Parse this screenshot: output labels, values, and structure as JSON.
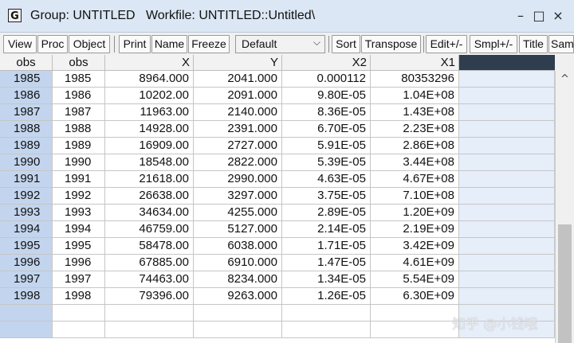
{
  "window": {
    "icon_letter": "G",
    "title": "Group: UNTITLED",
    "workfile": "Workfile: UNTITLED::Untitled\\",
    "minimize": "–",
    "maximize": "□",
    "close": "×"
  },
  "toolbar": {
    "buttons1": [
      "View",
      "Proc",
      "Object"
    ],
    "buttons2": [
      "Print",
      "Name",
      "Freeze"
    ],
    "select_value": "Default",
    "buttons3": [
      "Sort",
      "Transpose"
    ],
    "buttons4": [
      "Edit+/-",
      "Smpl+/-",
      "Title",
      "Sam"
    ]
  },
  "table": {
    "columns": [
      "obs",
      "obs",
      "X",
      "Y",
      "X2",
      "X1"
    ],
    "rows": [
      [
        "1985",
        "1985",
        "8964.000",
        "2041.000",
        "0.000112",
        "80353296"
      ],
      [
        "1986",
        "1986",
        "10202.00",
        "2091.000",
        "9.80E-05",
        "1.04E+08"
      ],
      [
        "1987",
        "1987",
        "11963.00",
        "2140.000",
        "8.36E-05",
        "1.43E+08"
      ],
      [
        "1988",
        "1988",
        "14928.00",
        "2391.000",
        "6.70E-05",
        "2.23E+08"
      ],
      [
        "1989",
        "1989",
        "16909.00",
        "2727.000",
        "5.91E-05",
        "2.86E+08"
      ],
      [
        "1990",
        "1990",
        "18548.00",
        "2822.000",
        "5.39E-05",
        "3.44E+08"
      ],
      [
        "1991",
        "1991",
        "21618.00",
        "2990.000",
        "4.63E-05",
        "4.67E+08"
      ],
      [
        "1992",
        "1992",
        "26638.00",
        "3297.000",
        "3.75E-05",
        "7.10E+08"
      ],
      [
        "1993",
        "1993",
        "34634.00",
        "4255.000",
        "2.89E-05",
        "1.20E+09"
      ],
      [
        "1994",
        "1994",
        "46759.00",
        "5127.000",
        "2.14E-05",
        "2.19E+09"
      ],
      [
        "1995",
        "1995",
        "58478.00",
        "6038.000",
        "1.71E-05",
        "3.42E+09"
      ],
      [
        "1996",
        "1996",
        "67885.00",
        "6910.000",
        "1.47E-05",
        "4.61E+09"
      ],
      [
        "1997",
        "1997",
        "74463.00",
        "8234.000",
        "1.34E-05",
        "5.54E+09"
      ],
      [
        "1998",
        "1998",
        "79396.00",
        "9263.000",
        "1.26E-05",
        "6.30E+09"
      ]
    ],
    "empty_rows": 2
  },
  "scrollbar": {
    "up_arrow": "^"
  },
  "watermark": "知乎 @小钱哦",
  "colors": {
    "title_bg": "#dbe7f4",
    "obs_col_bg": "#c3d5ee",
    "empty_col_bg": "#e6eefa",
    "header_selected_bg": "#2f3e4e"
  }
}
